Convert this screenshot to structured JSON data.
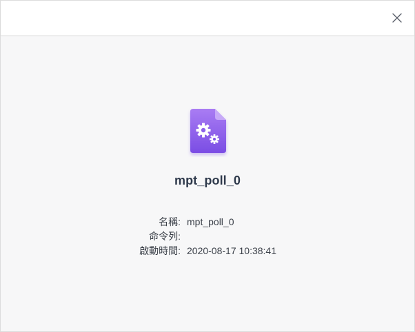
{
  "window": {
    "close_icon": "close-icon"
  },
  "process": {
    "icon": "gears-file-icon",
    "name": "mpt_poll_0"
  },
  "details": [
    {
      "label": "名稱:",
      "value": "mpt_poll_0"
    },
    {
      "label": "命令列:",
      "value": ""
    },
    {
      "label": "啟動時間:",
      "value": "2020-08-17 10:38:41"
    }
  ],
  "colors": {
    "icon_gradient_top": "#a97cf3",
    "icon_gradient_bottom": "#7c4fe6",
    "title_text": "#2f3a4c"
  }
}
